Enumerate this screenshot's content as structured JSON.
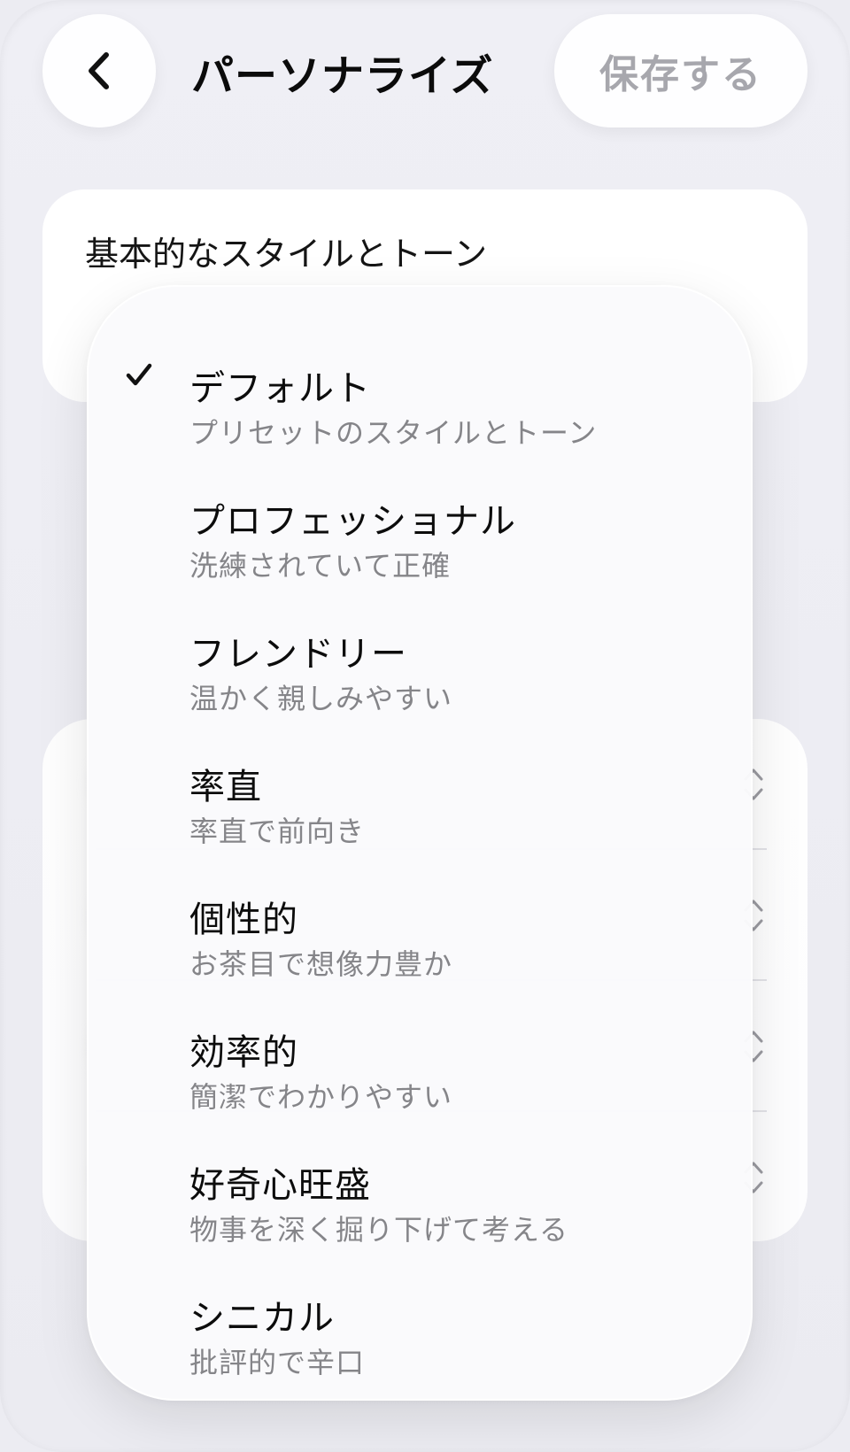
{
  "header": {
    "title": "パーソナライズ",
    "save_label": "保存する",
    "back_icon": "chevron-left-icon"
  },
  "style_section": {
    "label": "基本的なスタイルとトーン"
  },
  "menu": {
    "selected_index": 0,
    "items": [
      {
        "title": "デフォルト",
        "subtitle": "プリセットのスタイルとトーン",
        "selected": true
      },
      {
        "title": "プロフェッショナル",
        "subtitle": "洗練されていて正確",
        "selected": false
      },
      {
        "title": "フレンドリー",
        "subtitle": "温かく親しみやすい",
        "selected": false
      },
      {
        "title": "率直",
        "subtitle": "率直で前向き",
        "selected": false
      },
      {
        "title": "個性的",
        "subtitle": "お茶目で想像力豊か",
        "selected": false
      },
      {
        "title": "効率的",
        "subtitle": "簡潔でわかりやすい",
        "selected": false
      },
      {
        "title": "好奇心旺盛",
        "subtitle": "物事を深く掘り下げて考える",
        "selected": false
      },
      {
        "title": "シニカル",
        "subtitle": "批評的で辛口",
        "selected": false
      }
    ]
  },
  "colors": {
    "background": "#ececf2",
    "card": "#ffffff",
    "save_text": "#a7a7ad",
    "subtitle_text": "#858589"
  }
}
